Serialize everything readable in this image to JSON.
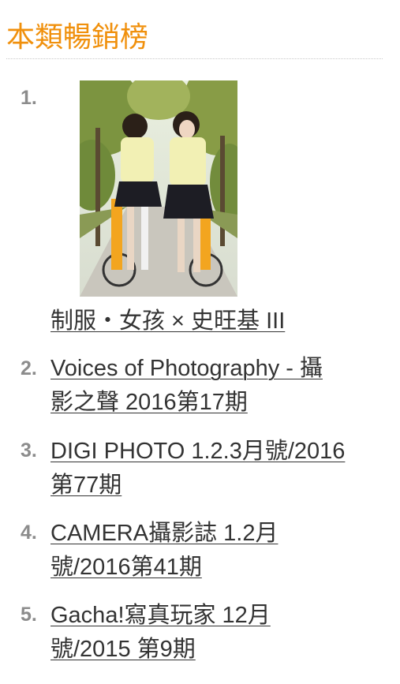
{
  "panel": {
    "title": "本類暢銷榜"
  },
  "bestsellers": [
    {
      "rank": "1.",
      "title_lines": [
        "制服・女孩 × 史旺基 III"
      ],
      "cover_icon": "book-cover-image"
    },
    {
      "rank": "2.",
      "title_lines": [
        "Voices of Photography - 攝",
        "影之聲 2016第17期"
      ]
    },
    {
      "rank": "3.",
      "title_lines": [
        "DIGI PHOTO 1.2.3月號/2016",
        "第77期"
      ]
    },
    {
      "rank": "4.",
      "title_lines": [
        "CAMERA攝影誌 1.2月",
        "號/2016第41期"
      ]
    },
    {
      "rank": "5.",
      "title_lines": [
        "Gacha!寫真玩家 12月",
        "號/2015 第9期"
      ]
    }
  ],
  "colors": {
    "title": "#f0900c",
    "rank": "#8c8c8c",
    "link": "#333333",
    "divider": "#c8c8c8"
  }
}
